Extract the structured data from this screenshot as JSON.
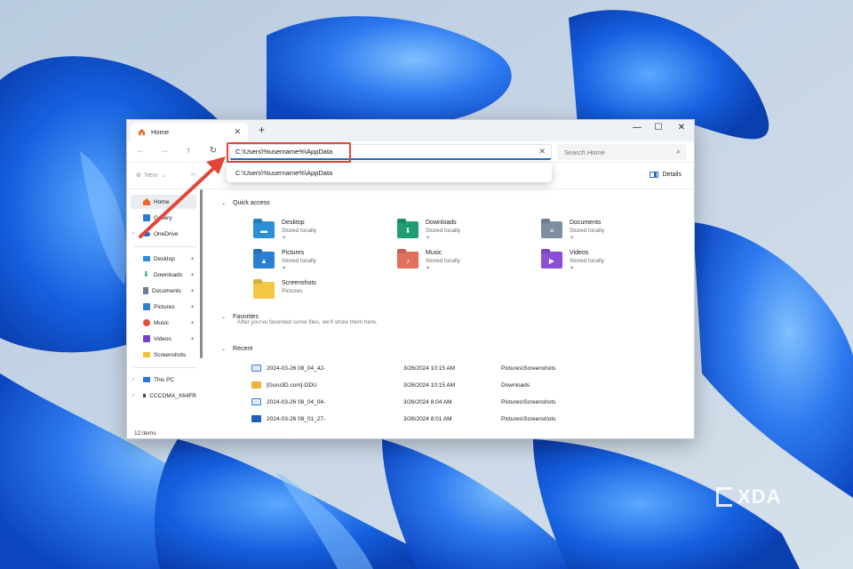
{
  "window": {
    "tab_title": "Home",
    "tab_close": "✕",
    "new_tab": "+",
    "minimize": "—",
    "maximize": "☐",
    "close": "✕"
  },
  "nav": {
    "back": "←",
    "forward": "→",
    "up": "↑",
    "refresh": "↻",
    "address_value": "C:\\Users\\%username%\\AppData",
    "address_clear": "✕",
    "search_placeholder": "Search Home",
    "search_glyph": "⌕"
  },
  "suggestion": "C:\\Users\\%username%\\AppData",
  "toolbar": {
    "new_label": "New",
    "details_label": "Details"
  },
  "sidebar": {
    "items": [
      {
        "label": "Home",
        "icon": "home-icon",
        "color": "#e86a2c"
      },
      {
        "label": "Gallery",
        "icon": "gallery-icon",
        "color": "#2a78d6"
      },
      {
        "label": "OneDrive",
        "icon": "cloud-icon",
        "color": "#1f6fd1"
      },
      {
        "label": "Desktop",
        "icon": "desktop-icon",
        "color": "#2a8fd6"
      },
      {
        "label": "Downloads",
        "icon": "download-icon",
        "color": "#1f9d74"
      },
      {
        "label": "Documents",
        "icon": "document-icon",
        "color": "#6b7d92"
      },
      {
        "label": "Pictures",
        "icon": "pictures-icon",
        "color": "#2b7fd3"
      },
      {
        "label": "Music",
        "icon": "music-icon",
        "color": "#e0533b"
      },
      {
        "label": "Videos",
        "icon": "videos-icon",
        "color": "#7a3fc8"
      },
      {
        "label": "Screenshots",
        "icon": "folder-icon",
        "color": "#f2c13a"
      },
      {
        "label": "This PC",
        "icon": "pc-icon",
        "color": "#2a78d6"
      },
      {
        "label": "CCCOMA_X64FR",
        "icon": "drive-icon",
        "color": "#444444"
      }
    ],
    "pin": "📌",
    "chevron": "›"
  },
  "quick_access": {
    "title": "Quick access",
    "items": [
      {
        "name": "Desktop",
        "sub": "Stored locally",
        "color": "#2a8fd6",
        "glyph": "▬"
      },
      {
        "name": "Downloads",
        "sub": "Stored locally",
        "color": "#1f9d74",
        "glyph": "⬇"
      },
      {
        "name": "Documents",
        "sub": "Stored locally",
        "color": "#7d8ea3",
        "glyph": "≡"
      },
      {
        "name": "Pictures",
        "sub": "Stored locally",
        "color": "#2b7fd3",
        "glyph": "▲"
      },
      {
        "name": "Music",
        "sub": "Stored locally",
        "color": "#e0705a",
        "glyph": "♪"
      },
      {
        "name": "Videos",
        "sub": "Stored locally",
        "color": "#8b4fd6",
        "glyph": "▶"
      },
      {
        "name": "Screenshots",
        "sub": "Pictures",
        "color": "#f2c744",
        "glyph": ""
      }
    ]
  },
  "favorites": {
    "title": "Favorites",
    "empty_text": "After you've favorited some files, we'll show them here."
  },
  "recent": {
    "title": "Recent",
    "rows": [
      {
        "name": "2024-03-26 08_04_42-",
        "date": "3/26/2024 10:15 AM",
        "location": "Pictures\\Screenshots",
        "color": "#3b7fd0"
      },
      {
        "name": "[Guru3D.com]-DDU",
        "date": "3/26/2024 10:15 AM",
        "location": "Downloads",
        "color": "#e8b63a"
      },
      {
        "name": "2024-03-26 08_04_04-",
        "date": "3/26/2024 8:04 AM",
        "location": "Pictures\\Screenshots",
        "color": "#3b7fd0"
      },
      {
        "name": "2024-03-26 08_01_27-",
        "date": "3/26/2024 8:01 AM",
        "location": "Pictures\\Screenshots",
        "color": "#1e5fb8"
      }
    ]
  },
  "status": {
    "item_count": "12 items"
  },
  "watermark": "XDA",
  "colors": {
    "accent": "#2a6fbe",
    "highlight_red": "#e0473a"
  }
}
